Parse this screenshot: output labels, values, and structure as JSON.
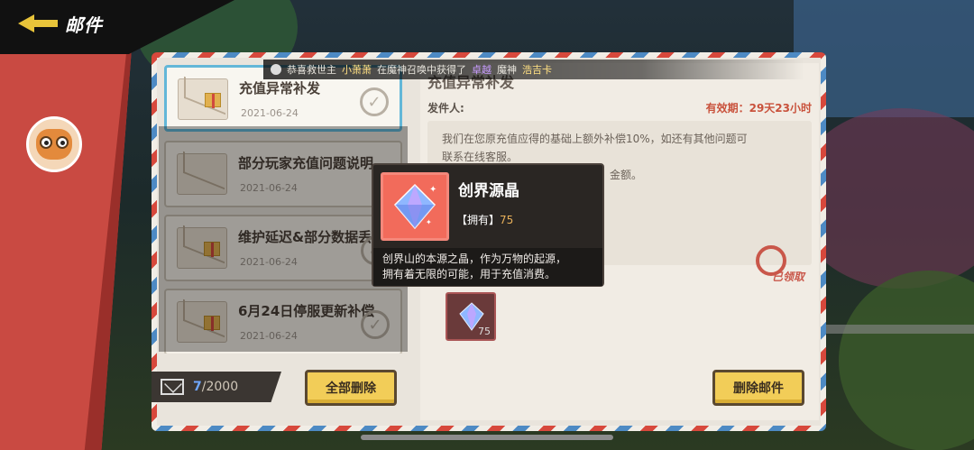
{
  "header": {
    "title": "邮件"
  },
  "ticker": {
    "prefix": "恭喜救世主",
    "player": "小萧萧",
    "middle": "在魔神召唤中获得了",
    "item_prefix": "卓越",
    "item_mid": "魔神",
    "item_name": "浩吉卡"
  },
  "mail_list": [
    {
      "subject": "充值异常补发",
      "date": "2021-06-24",
      "active": true
    },
    {
      "subject": "部分玩家充值问题说明",
      "date": "2021-06-24"
    },
    {
      "subject": "维护延迟&部分数据丢",
      "date": "2021-06-24"
    },
    {
      "subject": "6月24日停服更新补偿",
      "date": "2021-06-24"
    }
  ],
  "footer": {
    "count": "7",
    "total": "/2000",
    "delete_all": "全部删除",
    "delete_mail": "删除邮件"
  },
  "detail": {
    "title": "充值异常补发",
    "sender_label": "发件人:",
    "expiry": "有效期：29天23小时",
    "body_line1": "我们在您原充值应得的基础上额外补偿10%，如还有其他问题可",
    "body_line2": "联系在线客服。",
    "body_line3": "金额。",
    "claimed_stamp": "已领取",
    "reward_qty": "75"
  },
  "tooltip": {
    "name": "创界源晶",
    "own_label": "【拥有】",
    "own_value": "75",
    "desc_line1": "创界山的本源之晶，作为万物的起源，",
    "desc_line2": "拥有着无限的可能，用于充值消费。"
  }
}
